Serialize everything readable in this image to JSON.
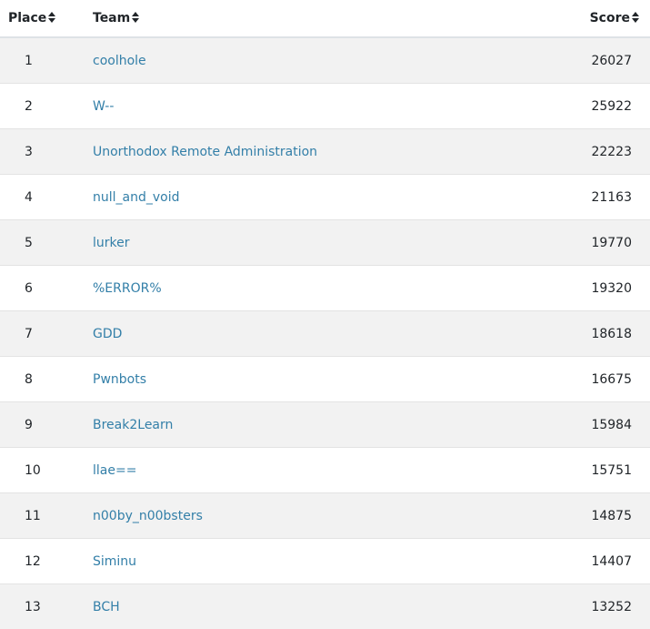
{
  "headers": {
    "place": "Place",
    "team": "Team",
    "score": "Score"
  },
  "rows": [
    {
      "place": "1",
      "team": "coolhole",
      "score": "26027"
    },
    {
      "place": "2",
      "team": "W--",
      "score": "25922"
    },
    {
      "place": "3",
      "team": "Unorthodox Remote Administration",
      "score": "22223"
    },
    {
      "place": "4",
      "team": "null_and_void",
      "score": "21163"
    },
    {
      "place": "5",
      "team": "lurker",
      "score": "19770"
    },
    {
      "place": "6",
      "team": "%ERROR%",
      "score": "19320"
    },
    {
      "place": "7",
      "team": "GDD",
      "score": "18618"
    },
    {
      "place": "8",
      "team": "Pwnbots",
      "score": "16675"
    },
    {
      "place": "9",
      "team": "Break2Learn",
      "score": "15984"
    },
    {
      "place": "10",
      "team": "llae==",
      "score": "15751"
    },
    {
      "place": "11",
      "team": "n00by_n00bsters",
      "score": "14875"
    },
    {
      "place": "12",
      "team": "Siminu",
      "score": "14407"
    },
    {
      "place": "13",
      "team": "BCH",
      "score": "13252"
    }
  ],
  "colors": {
    "link": "#337fa8",
    "stripe": "#f2f2f2",
    "text": "#212529"
  },
  "icons": {
    "sort": "sort-icon"
  }
}
